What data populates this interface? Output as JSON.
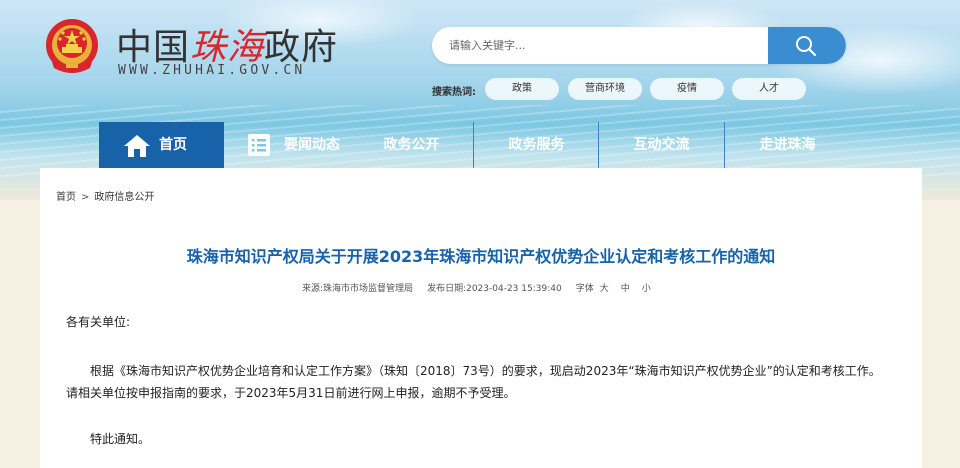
{
  "header": {
    "title_prefix": "中国",
    "title_red": "珠海",
    "title_suffix": "政府",
    "url": "WWW.ZHUHAI.GOV.CN"
  },
  "search": {
    "placeholder": "请输入关键字...",
    "hot_label": "搜索热词:",
    "hot_words": [
      "政策",
      "营商环境",
      "疫情",
      "人才"
    ]
  },
  "nav": {
    "items": [
      "首页",
      "要闻动态",
      "政务公开",
      "政务服务",
      "互动交流",
      "走进珠海"
    ]
  },
  "breadcrumb": [
    "首页",
    "政府信息公开"
  ],
  "article": {
    "title": "珠海市知识产权局关于开展2023年珠海市知识产权优势企业认定和考核工作的通知",
    "source_label": "来源:",
    "source": "珠海市市场监督管理局",
    "date_label": "发布日期:",
    "date": "2023-04-23 15:39:40",
    "font_label": "字体",
    "font_sizes": [
      "大",
      "中",
      "小"
    ],
    "greeting": "各有关单位:",
    "paragraph": "根据《珠海市知识产权优势企业培育和认定工作方案》（珠知〔2018〕73号）的要求，现启动2023年“珠海市知识产权优势企业”的认定和考核工作。请相关单位按申报指南的要求，于2023年5月31日前进行网上申报，逾期不予受理。",
    "closing": "特此通知。"
  },
  "colors": {
    "brand_blue": "#1762a9",
    "title_red": "#d8262c",
    "search_blue": "#3a8dd0"
  }
}
